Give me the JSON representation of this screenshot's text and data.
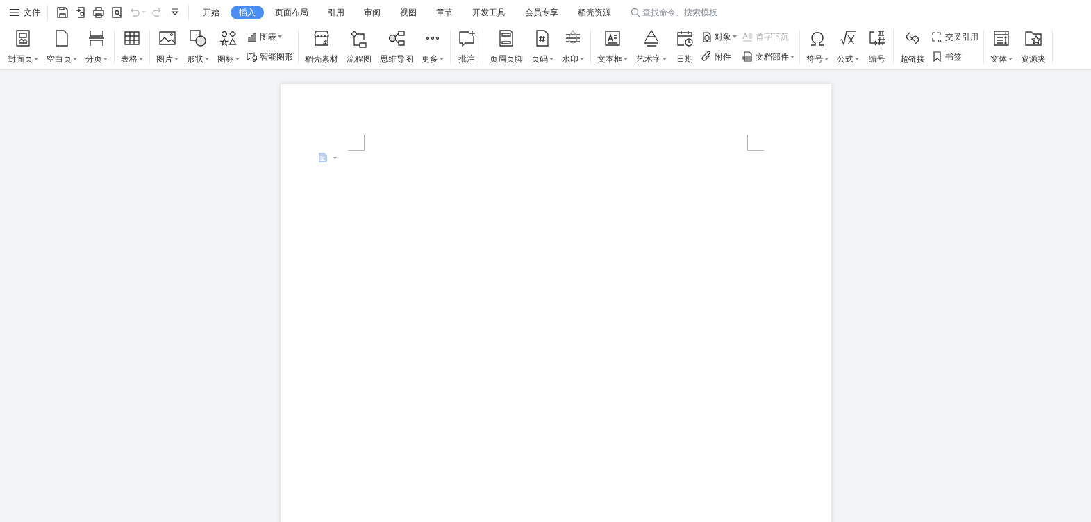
{
  "menu": {
    "label": "文件"
  },
  "quick_access": [
    {
      "kind": "save",
      "disabled": false
    },
    {
      "kind": "export",
      "disabled": false
    },
    {
      "kind": "print",
      "disabled": false
    },
    {
      "kind": "preview",
      "disabled": false
    },
    {
      "kind": "undo",
      "disabled": true
    },
    {
      "kind": "redo",
      "disabled": true
    },
    {
      "kind": "customize",
      "disabled": false
    }
  ],
  "tabs": [
    {
      "label": "开始",
      "selected": false
    },
    {
      "label": "插入",
      "selected": true
    },
    {
      "label": "页面布局",
      "selected": false
    },
    {
      "label": "引用",
      "selected": false
    },
    {
      "label": "审阅",
      "selected": false
    },
    {
      "label": "视图",
      "selected": false
    },
    {
      "label": "章节",
      "selected": false
    },
    {
      "label": "开发工具",
      "selected": false
    },
    {
      "label": "会员专享",
      "selected": false
    },
    {
      "label": "稻壳资源",
      "selected": false
    }
  ],
  "search": {
    "placeholder": "查找命令、搜索模板"
  },
  "ribbon_groups": [
    {
      "items": [
        {
          "kind": "large",
          "label": "封面页",
          "dropdown": true
        },
        {
          "kind": "large",
          "label": "空白页",
          "dropdown": true
        },
        {
          "kind": "large",
          "label": "分页",
          "dropdown": true
        }
      ]
    },
    {
      "items": [
        {
          "kind": "large",
          "label": "表格",
          "dropdown": true
        }
      ]
    },
    {
      "items": [
        {
          "kind": "large",
          "label": "图片",
          "dropdown": true
        },
        {
          "kind": "large",
          "label": "形状",
          "dropdown": true
        },
        {
          "kind": "large",
          "label": "图标",
          "dropdown": true
        },
        {
          "kind": "stack",
          "entries": [
            {
              "label": "图表",
              "dropdown": true,
              "disabled": false
            },
            {
              "label": "智能图形",
              "dropdown": false,
              "disabled": false
            }
          ]
        }
      ]
    },
    {
      "items": [
        {
          "kind": "large",
          "label": "稻壳素材",
          "dropdown": false
        },
        {
          "kind": "large",
          "label": "流程图",
          "dropdown": false
        },
        {
          "kind": "large",
          "label": "思维导图",
          "dropdown": false
        },
        {
          "kind": "large",
          "label": "更多",
          "dropdown": true
        }
      ]
    },
    {
      "items": [
        {
          "kind": "large",
          "label": "批注",
          "dropdown": false
        }
      ]
    },
    {
      "items": [
        {
          "kind": "large",
          "label": "页眉页脚",
          "dropdown": false
        },
        {
          "kind": "large",
          "label": "页码",
          "dropdown": true
        },
        {
          "kind": "large",
          "label": "水印",
          "dropdown": true
        }
      ]
    },
    {
      "items": [
        {
          "kind": "large",
          "label": "文本框",
          "dropdown": true
        },
        {
          "kind": "large",
          "label": "艺术字",
          "dropdown": true
        },
        {
          "kind": "large",
          "label": "日期",
          "dropdown": false
        },
        {
          "kind": "stack",
          "entries": [
            {
              "label": "对象",
              "dropdown": true,
              "disabled": false
            },
            {
              "label": "附件",
              "dropdown": false,
              "disabled": false
            }
          ]
        },
        {
          "kind": "stack",
          "entries": [
            {
              "label": "首字下沉",
              "dropdown": false,
              "disabled": true
            },
            {
              "label": "文档部件",
              "dropdown": true,
              "disabled": false
            }
          ]
        }
      ]
    },
    {
      "items": [
        {
          "kind": "large",
          "label": "符号",
          "dropdown": true
        },
        {
          "kind": "large",
          "label": "公式",
          "dropdown": true
        },
        {
          "kind": "large",
          "label": "编号",
          "dropdown": false
        }
      ]
    },
    {
      "items": [
        {
          "kind": "large",
          "label": "超链接",
          "dropdown": false
        },
        {
          "kind": "stack",
          "entries": [
            {
              "label": "交叉引用",
              "dropdown": false,
              "disabled": false
            },
            {
              "label": "书签",
              "dropdown": false,
              "disabled": false
            }
          ]
        }
      ]
    },
    {
      "items": [
        {
          "kind": "large",
          "label": "窗体",
          "dropdown": true
        },
        {
          "kind": "large",
          "label": "资源夹",
          "dropdown": false
        }
      ]
    }
  ]
}
